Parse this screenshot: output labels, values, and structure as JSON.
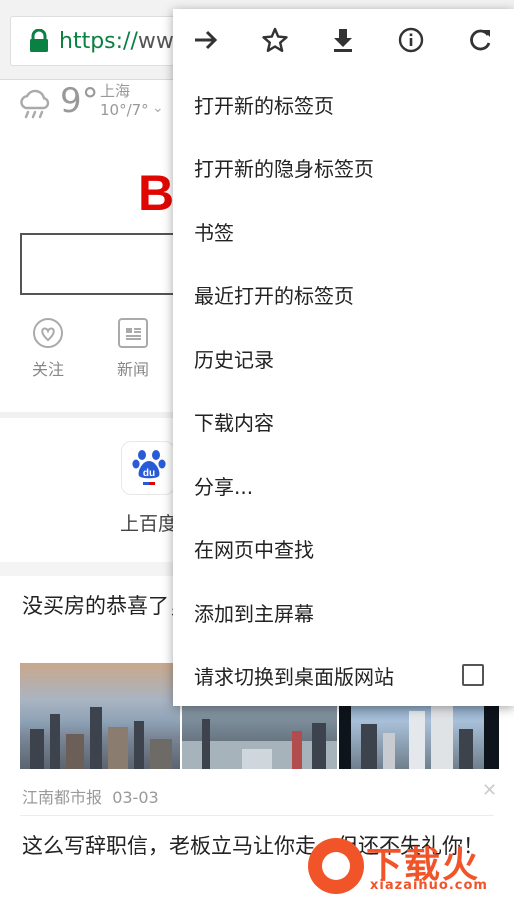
{
  "address_bar": {
    "scheme": "https://",
    "rest": "www"
  },
  "weather": {
    "temp": "9°",
    "city": "上海",
    "range": "10°/7°",
    "chevron": "⌄"
  },
  "logo_fragment": "B",
  "quick_links": [
    {
      "label": "关注",
      "icon": "heart-icon"
    },
    {
      "label": "新闻",
      "icon": "news-icon"
    }
  ],
  "app_shortcut": {
    "label": "上百度",
    "icon": "baidu-paw-icon"
  },
  "feed": [
    {
      "title": "没买房的恭喜了，房价将......",
      "source": "江南都市报",
      "date": "03-03",
      "close": "✕"
    },
    {
      "title": "这么写辞职信，老板立马让你走，但还不失礼你！"
    }
  ],
  "menu": {
    "icons": [
      "forward-icon",
      "star-icon",
      "download-icon",
      "info-icon",
      "refresh-icon"
    ],
    "items": [
      {
        "label": "打开新的标签页"
      },
      {
        "label": "打开新的隐身标签页"
      },
      {
        "label": "书签"
      },
      {
        "label": "最近打开的标签页"
      },
      {
        "label": "历史记录"
      },
      {
        "label": "下载内容"
      },
      {
        "label": "分享..."
      },
      {
        "label": "在网页中查找"
      },
      {
        "label": "添加到主屏幕"
      },
      {
        "label": "请求切换到桌面版网站",
        "checkbox": false
      }
    ]
  },
  "watermark": {
    "text": "下载火",
    "sub": "xiazaihuo.com"
  },
  "colors": {
    "secure_green": "#0b8043",
    "baidu_red": "#e10601",
    "watermark_orange": "#f2542a"
  }
}
